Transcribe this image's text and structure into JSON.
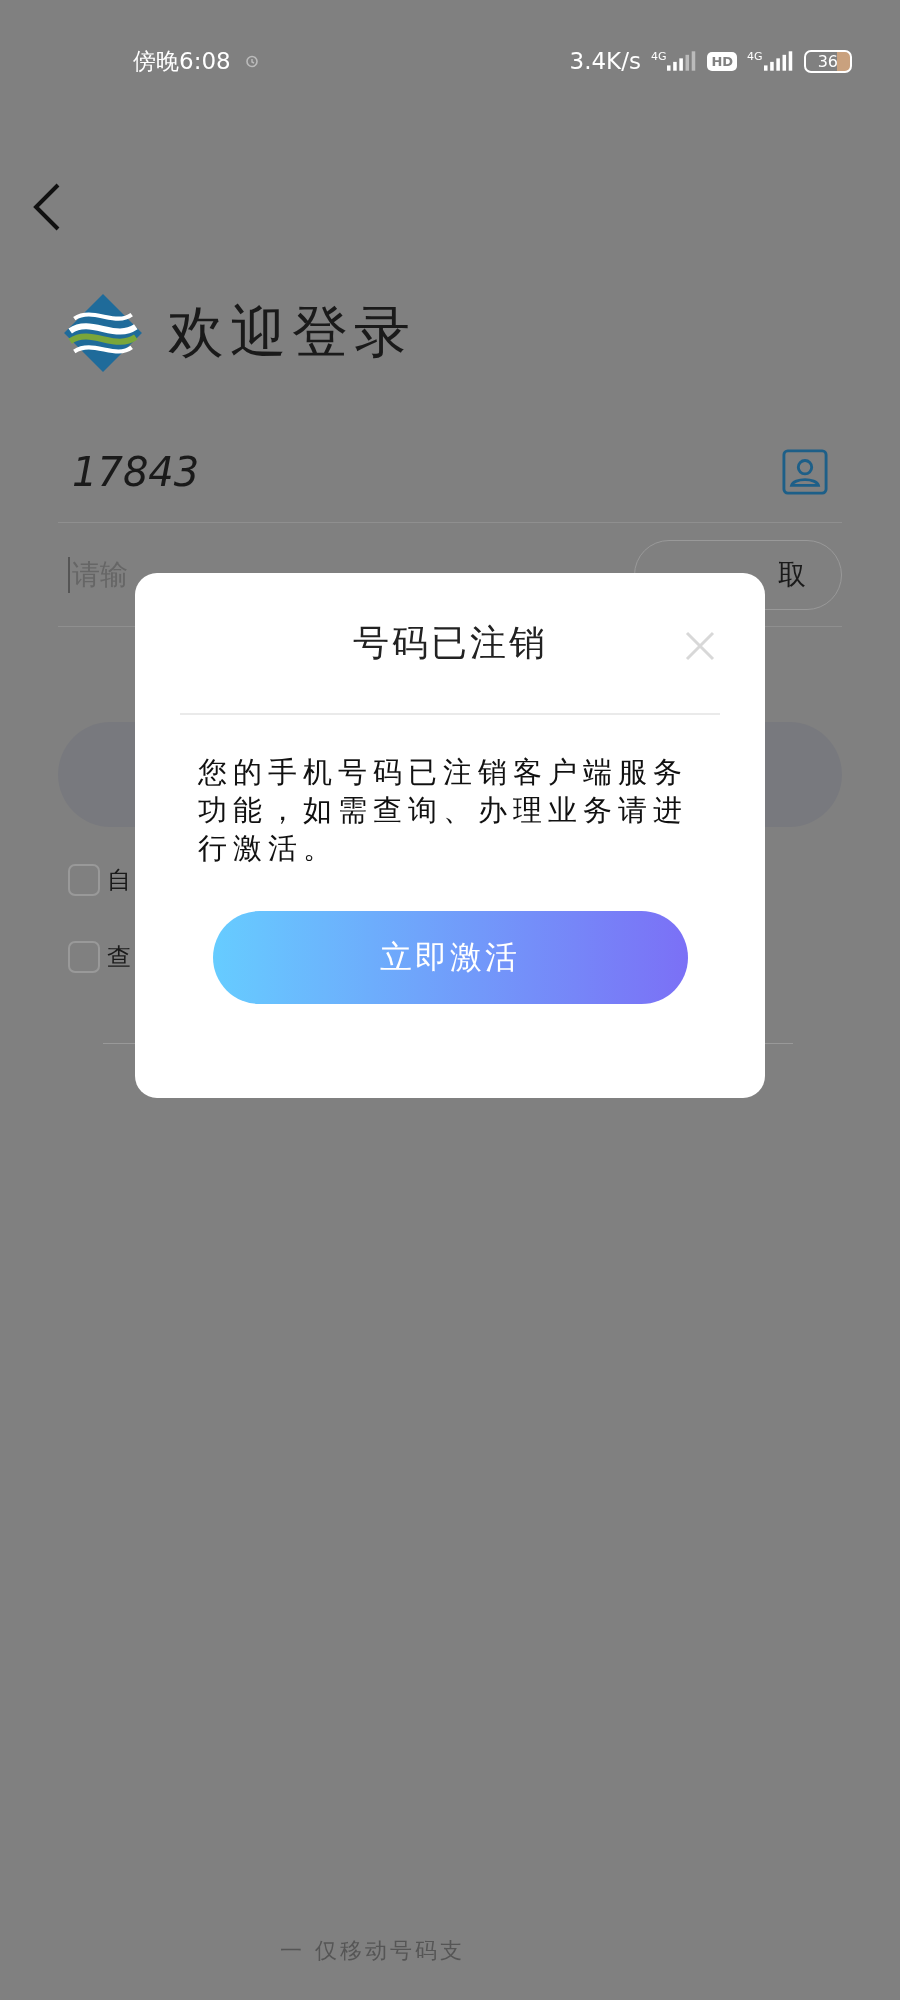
{
  "status_bar": {
    "time": "傍晚6:08",
    "net_speed": "3.4K/s",
    "sim1_type": "4G",
    "hd": "HD",
    "sim2_type": "4G",
    "battery": "36"
  },
  "header": {
    "title": "欢迎登录"
  },
  "phone_field": {
    "value": "17843"
  },
  "code_field": {
    "placeholder": "请输",
    "button": "取"
  },
  "options": [
    {
      "label": "自",
      "checked": false
    },
    {
      "label": "查",
      "checked": false
    }
  ],
  "dialog": {
    "title": "号码已注销",
    "message": "您的手机号码已注销客户端服务功能，如需查询、办理业务请进行激活。",
    "button": "立即激活"
  },
  "footer": {
    "note": "一 仅移动号码支"
  }
}
